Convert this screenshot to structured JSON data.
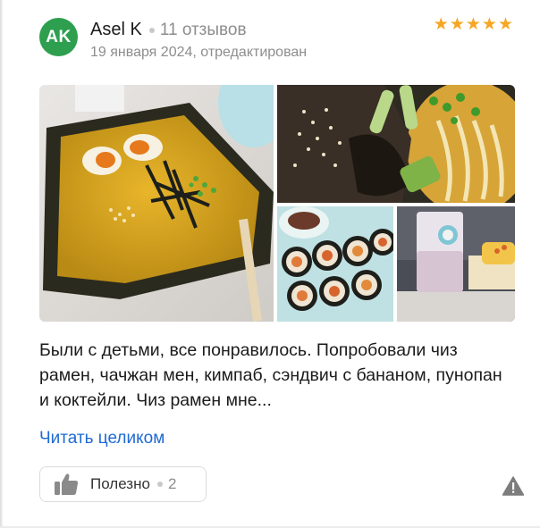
{
  "author": {
    "initials": "AK",
    "name": "Asel K",
    "reviews": "11 отзывов",
    "avatar_color": "#2e9f4f"
  },
  "date": "19 января 2024, отредактирован",
  "rating": {
    "value": 5,
    "max": 5,
    "color": "#f6a623"
  },
  "photos": [
    {
      "subject": "cheese ramen bowl"
    },
    {
      "subject": "jjajang noodles"
    },
    {
      "subject": "kimbap rolls"
    },
    {
      "subject": "milk cocktail and sandwich"
    }
  ],
  "review_text": "Были с детьми, все понравилось. Попробовали чиз рамен, чачжан мен, кимпаб, сэндвич с бананом, пунопан и коктейли. Чиз рамен мне...",
  "read_more": "Читать целиком",
  "useful": {
    "label": "Полезно",
    "count": "2"
  },
  "colors": {
    "link": "#1e6ad3",
    "muted": "#8d8d8d"
  },
  "icons": [
    "thumbs-up-icon",
    "warning-icon",
    "star-icon"
  ]
}
